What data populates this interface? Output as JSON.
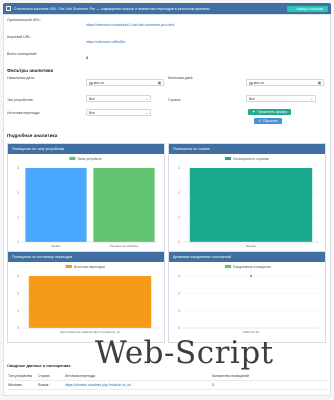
{
  "header": {
    "title": "Статистика коротких URL: Ole Link Shortener Pro — сокращение ссылок и аналитика переходов в реальном времени",
    "back_label": "← Назад к ссылкам"
  },
  "info": {
    "original_label": "Оригинальный URL:",
    "original_value": "https://olemoni.ru/modules/1-ole-link-shortener-pro.html",
    "short_label": "Короткий URL:",
    "short_value": "https://olemoni.ru/Bm5kt",
    "total_label": "Всего посещений:",
    "total_value": "3"
  },
  "filters": {
    "title": "Фильтры аналитики",
    "start_label": "Начальная дата:",
    "start_value": "дд.мм.гггг",
    "end_label": "Конечная дата:",
    "end_value": "дд.мм.гггг",
    "device_label": "Тип устройства:",
    "device_value": "Все",
    "country_label": "Страна:",
    "country_value": "Все",
    "source_label": "Источник перехода:",
    "source_value": "Все",
    "apply_label": "Применить фильтр",
    "reset_label": "Сбросить"
  },
  "detailed_title": "Подробная аналитика",
  "charts": {
    "device_title": "Посещения по типу устройства",
    "country_title": "Посещения по стране",
    "source_title": "Посещения по источнику переходов",
    "daily_title": "Динамика ежедневных посещений"
  },
  "chart_data": [
    {
      "type": "bar",
      "series": [
        {
          "name": "Типы устройств",
          "values": [
            3,
            3
          ]
        }
      ],
      "categories": [
        "Mobile",
        "Неизвестно (Mobile)"
      ],
      "ylim": [
        0,
        3
      ],
      "yticks": [
        "0",
        "1",
        "2",
        "3"
      ],
      "colors": [
        "#4aa8ff",
        "#62c370"
      ]
    },
    {
      "type": "bar",
      "series": [
        {
          "name": "Посещения по странам",
          "values": [
            3
          ]
        }
      ],
      "categories": [
        "Russia"
      ],
      "ylim": [
        0,
        3
      ],
      "yticks": [
        "0",
        "1",
        "2",
        "3"
      ],
      "colors": [
        "#1aa88f"
      ]
    },
    {
      "type": "bar",
      "series": [
        {
          "name": "Источник переходов",
          "values": [
            3
          ]
        }
      ],
      "categories": [
        "https://olemoni.ru/admin.php?module=ol_sh"
      ],
      "ylim": [
        0,
        3
      ],
      "yticks": [
        "0",
        "1",
        "2",
        "3"
      ],
      "colors": [
        "#f59b17"
      ]
    },
    {
      "type": "line",
      "series": [
        {
          "name": "Ежедневные посещения",
          "values": [
            3
          ]
        }
      ],
      "categories": [
        "2025-02-19"
      ],
      "ylim": [
        0,
        3
      ],
      "yticks": [
        "0",
        "1",
        "2",
        "3"
      ],
      "colors": [
        "#62c370"
      ]
    }
  ],
  "visits": {
    "title": "Сводные данные о посещениях",
    "headers": [
      "Тип устройства",
      "Страна",
      "Источник перехода",
      "Количество посещений"
    ],
    "rows": [
      [
        "Windows",
        "Russia",
        "https://olemoni.ru/admin.php?module=ol_sh",
        "3"
      ]
    ]
  },
  "watermark": "Web-Script"
}
